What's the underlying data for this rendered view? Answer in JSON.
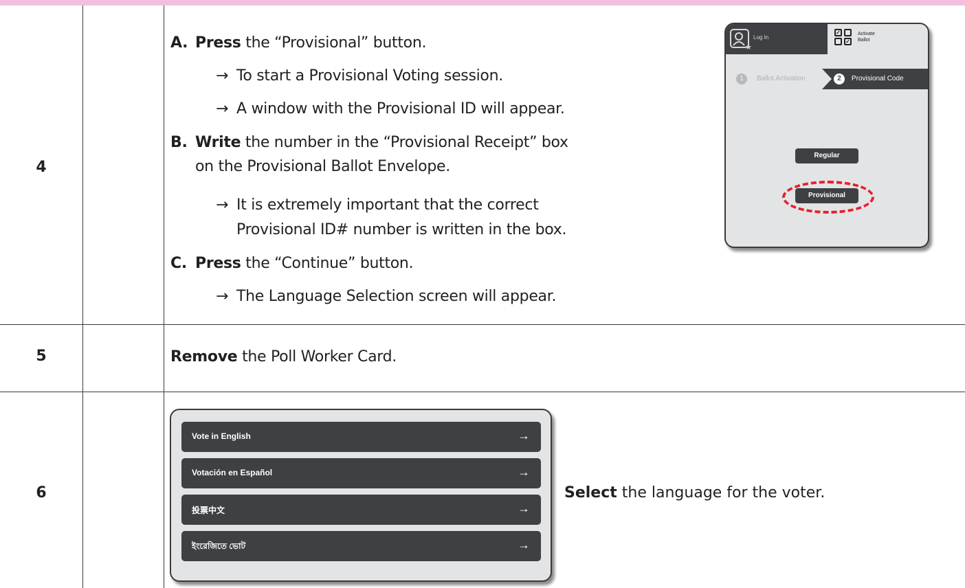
{
  "rows": [
    {
      "number": "4",
      "instructions": [
        {
          "letter": "A.",
          "bold": "Press",
          "rest": " the “Provisional” button."
        },
        {
          "arrow": "→",
          "text": "To start a Provisional Voting session."
        },
        {
          "arrow": "→",
          "text": "A window with the Provisional ID will appear."
        },
        {
          "letter": "B.",
          "bold": "Write",
          "rest": " the number in the “Provisional Receipt” box"
        },
        {
          "text": "on the Provisional Ballot Envelope."
        },
        {
          "arrow": "→",
          "text": "It is extremely important that the correct"
        },
        {
          "text": "Provisional ID# number is written in the box."
        },
        {
          "letter": "C.",
          "bold": "Press",
          "rest": " the “Continue” button."
        },
        {
          "arrow": "→",
          "text": "The Language Selection screen will appear."
        }
      ]
    },
    {
      "number": "5",
      "instruction": {
        "bold": "Remove",
        "rest": " the Poll Worker Card."
      }
    },
    {
      "number": "6",
      "instruction": {
        "bold": "Select",
        "rest": " the language for the voter."
      }
    }
  ],
  "screen1": {
    "login_label": "Log In",
    "activate_label_1": "Activate",
    "activate_label_2": "Ballot",
    "steps": [
      {
        "num": "1",
        "label": "Ballot Activation"
      },
      {
        "num": "2",
        "label": "Provisional Code"
      }
    ],
    "regular_button": "Regular",
    "provisional_button": "Provisional",
    "highlight_color": "#e8202a"
  },
  "screen2": {
    "languages": [
      {
        "label": "Vote in English",
        "arrow": "→"
      },
      {
        "label": "Votación en Español",
        "arrow": "→"
      },
      {
        "label": "投票中文",
        "arrow": "→"
      },
      {
        "label": "ইংরেজিতে ভোট",
        "arrow": "→"
      }
    ]
  },
  "colors": {
    "band": "#f2bfe0",
    "ui_dark": "#3f4043",
    "ui_light": "#e3e4e6"
  }
}
